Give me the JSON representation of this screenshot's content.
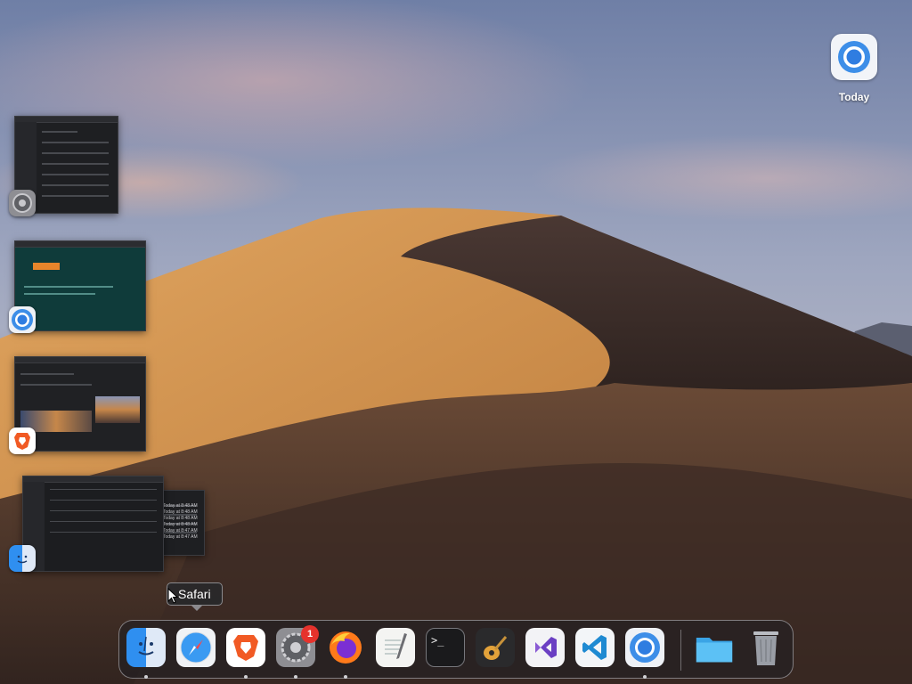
{
  "desktop": {
    "icons": [
      {
        "label": "Today",
        "icon": "chromium-icon"
      }
    ]
  },
  "expose": {
    "windows": [
      {
        "app": "System Preferences",
        "icon": "system-preferences-icon"
      },
      {
        "app": "Chromium",
        "icon": "chromium-icon"
      },
      {
        "app": "Brave Browser",
        "icon": "brave-icon"
      },
      {
        "app": "Finder",
        "icon": "finder-icon"
      }
    ],
    "finder_dates": [
      "Today at 8:48 AM",
      "Today at 8:48 AM",
      "Today at 8:48 AM",
      "Today at 8:48 AM",
      "Today at 8:47 AM",
      "Today at 8:47 AM"
    ]
  },
  "tooltip": {
    "text": "Safari"
  },
  "dock": {
    "items": [
      {
        "name": "Finder",
        "icon": "finder-icon",
        "running": true
      },
      {
        "name": "Safari",
        "icon": "safari-icon",
        "running": false
      },
      {
        "name": "Brave Browser",
        "icon": "brave-icon",
        "running": true
      },
      {
        "name": "System Preferences",
        "icon": "system-preferences-icon",
        "running": true,
        "badge": "1"
      },
      {
        "name": "Firefox",
        "icon": "firefox-icon",
        "running": true
      },
      {
        "name": "TextEdit",
        "icon": "textedit-icon",
        "running": false
      },
      {
        "name": "Terminal",
        "icon": "terminal-icon",
        "running": false
      },
      {
        "name": "GarageBand",
        "icon": "garageband-icon",
        "running": false
      },
      {
        "name": "Visual Studio",
        "icon": "visual-studio-icon",
        "running": false
      },
      {
        "name": "Visual Studio Code",
        "icon": "vscode-icon",
        "running": false
      },
      {
        "name": "Chromium",
        "icon": "chromium-icon",
        "running": true
      },
      {
        "name": "Downloads",
        "icon": "folder-icon",
        "running": false
      },
      {
        "name": "Trash",
        "icon": "trash-icon",
        "running": false
      }
    ],
    "terminal_prompt": ">_"
  },
  "colors": {
    "accent_blue": "#2f7de1",
    "badge_red": "#e6322c",
    "brave_orange": "#f15a24",
    "folder_blue": "#4db4f0"
  }
}
